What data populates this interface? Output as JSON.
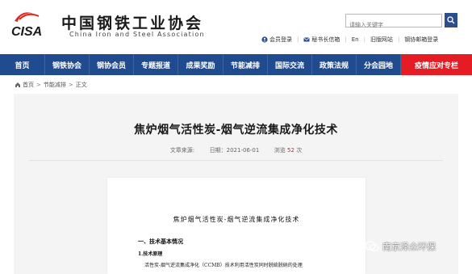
{
  "header": {
    "site_name_zh": "中国钢铁工业协会",
    "site_name_en": "China Iron and Steel Association",
    "logo_text": "CISA",
    "search_placeholder": "请输入关键字",
    "top_links": [
      "会员登录",
      "秘书长信箱",
      "En",
      "旧版网站",
      "钢协邮箱登录"
    ]
  },
  "nav": {
    "items": [
      "首页",
      "钢铁协会",
      "钢协会员",
      "专题报道",
      "成果奖励",
      "节能减排",
      "国际交流",
      "政策法规",
      "分会园地"
    ],
    "special_item": "疫情应对专栏"
  },
  "breadcrumb": {
    "items": [
      "首页",
      "节能减排",
      "正文"
    ],
    "separator": ">"
  },
  "article": {
    "title": "焦炉烟气活性炭-烟气逆流集成净化技术",
    "source_label": "文章来源:",
    "date_label": "日期：2021-06-01",
    "views_label": "浏览",
    "views_count": "52",
    "views_unit": "次"
  },
  "document": {
    "title": "焦炉烟气活性炭-烟气逆流集成净化技术",
    "section": "一、技术基本情况",
    "subsection": "1.技术原理",
    "text": "活性炭-烟气逆流集成净化（CCMB）技术利用活性炭同时脱硫脱硝的处理"
  },
  "watermark": {
    "text": "南京泽众环保"
  },
  "colors": {
    "nav_bg": "#214b8f",
    "special_bg": "#e51c23",
    "logo_red": "#e2231a",
    "views_red": "#e51c23"
  }
}
